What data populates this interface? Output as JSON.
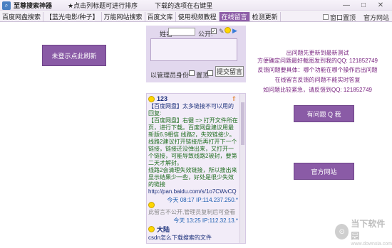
{
  "titlebar": {
    "app_title": "至尊搜索神器",
    "hint1": "★点击列标题可进行排序",
    "hint2": "下载的选项在右键里",
    "min": "—",
    "max": "□",
    "close": "✕"
  },
  "tabs": [
    {
      "label": "百度网盘搜索"
    },
    {
      "label": "【蓝光电影/种子】"
    },
    {
      "label": "万能网站搜索"
    },
    {
      "label": "百度文库"
    },
    {
      "label": "使用视频教程"
    },
    {
      "label": "在线留言",
      "active": true
    },
    {
      "label": "检测更新"
    }
  ],
  "tabbar_right": {
    "window_top": "窗口置顶",
    "official_site": "官方网站"
  },
  "left": {
    "refresh_button": "未登示点此刷新"
  },
  "form": {
    "name_label": "姓名",
    "name_value": "",
    "public_label": "公开:",
    "public_checked": "✓",
    "edit_icon": "✎",
    "send_icon": "▶",
    "id_label": "以管理员身份",
    "top_label": "置顶",
    "submit_label": "提交留言"
  },
  "messages": [
    {
      "user": "123",
      "lines": [
        "【百度网盘】太多链接不可以用的"
      ],
      "reply_label": "回复:",
      "reply": [
        "【百度网盘】右键 => 打开文件所在页，进行下载。百度网盘建议用最新版6.9相信 线路2，失效链接少。",
        "线路2建议打开链接后再打开下一个链接，链接还没弹出来，又打开一个链接，可能导致线路2被封，要第二天才解封。",
        "线路2会清理失效链接，所以搜出来显示结果少一些，好处是很少失效的链接",
        "http://pan.baidu.com/s/1o7CWvCQ"
      ],
      "meta": "今天 08:17 IP:114.237.250.*"
    },
    {
      "lines": [
        "此留言不公开,管理员复制后可查看"
      ],
      "meta": "今天 13:25 IP:112.32.13.*"
    },
    {
      "user": "大陆",
      "lines": [
        "csdn怎么下载搜索的文件"
      ]
    }
  ],
  "info": {
    "line1": "出问题先更新到最新测试",
    "line2": "方便确定问题最好截图发到我的QQ: 121852749",
    "line3": "反馈问题要具体：哪个功能在哪个操作后出问题",
    "line4": "在线留言反馈的问题不能实时答复",
    "line5": "如问题比较紧急，请反馈到QQ: 121852749",
    "qq_button": "有问题 Q 我",
    "site_button": "官方网站"
  },
  "watermark": {
    "logo_glyph": "⊙",
    "name": "当下软件园",
    "url": "www.downxia.com"
  },
  "colors": {
    "accent": "#8a5ba6",
    "info_text": "#7a2580",
    "reply_text": "#1f6e1f"
  }
}
